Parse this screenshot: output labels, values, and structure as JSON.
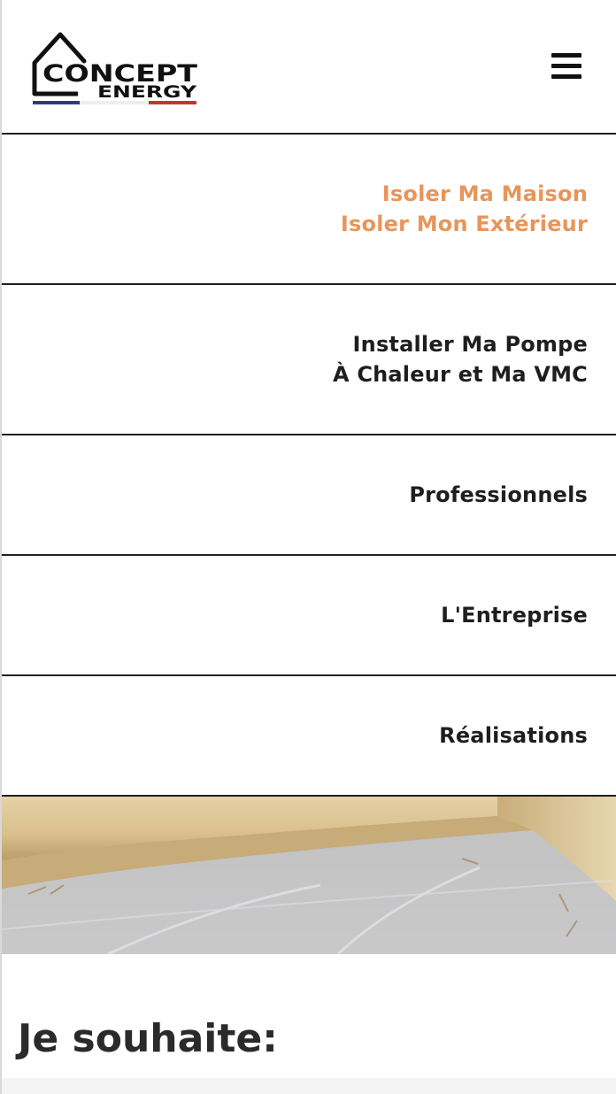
{
  "header": {
    "logo": {
      "name_top": "CONCEPT",
      "name_bottom": "ENERGY",
      "flag_colors": [
        "#2b3a8c",
        "#ffffff",
        "#c0392b"
      ]
    },
    "menu_icon": "hamburger-menu-icon"
  },
  "nav": {
    "items": [
      {
        "lines": [
          "Isoler Ma Maison",
          "Isoler Mon Extérieur"
        ],
        "active": true
      },
      {
        "lines": [
          "Installer Ma Pompe",
          "À Chaleur et Ma VMC"
        ],
        "active": false
      },
      {
        "lines": [
          "Professionnels"
        ],
        "active": false
      },
      {
        "lines": [
          "L'Entreprise"
        ],
        "active": false
      },
      {
        "lines": [
          "Réalisations"
        ],
        "active": false
      }
    ]
  },
  "main": {
    "heading": "Je souhaite:"
  },
  "colors": {
    "accent": "#e8955a",
    "text": "#1e1e1e",
    "divider": "#1f1f1f"
  }
}
